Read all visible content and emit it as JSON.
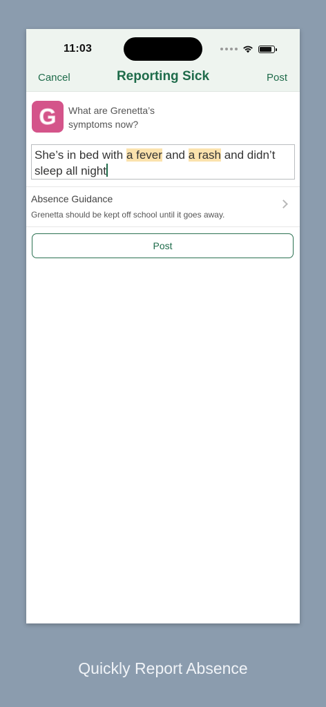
{
  "status_bar": {
    "time": "11:03"
  },
  "nav": {
    "cancel_label": "Cancel",
    "title": "Reporting Sick",
    "post_label": "Post"
  },
  "child": {
    "initial": "G",
    "avatar_color": "#d4548a",
    "prompt_line1": "What are Grenetta’s",
    "prompt_line2": "symptoms now?"
  },
  "symptoms_input": {
    "part1": "She’s in bed with ",
    "highlight1": "a fever",
    "part2": " and ",
    "highlight2": "a rash",
    "part3": " and didn’t sleep all night",
    "highlight_color": "#fbe2ad"
  },
  "guidance": {
    "title": "Absence Guidance",
    "description": "Grenetta should be kept off school until it goes away."
  },
  "post_button": {
    "label": "Post"
  },
  "caption": "Quickly Report Absence",
  "colors": {
    "accent": "#1e6b4a",
    "background": "#8b9cae",
    "header_bg": "#eef4ef"
  }
}
